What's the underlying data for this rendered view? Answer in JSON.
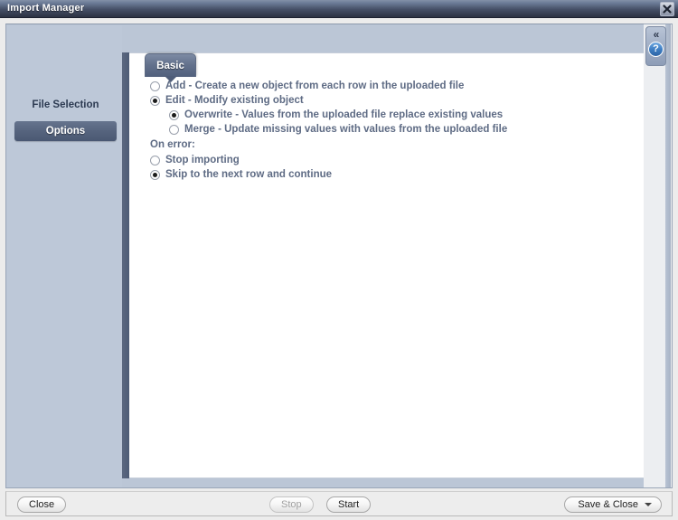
{
  "window": {
    "title": "Import Manager",
    "close_icon": "close-icon"
  },
  "sidebar": {
    "items": [
      {
        "label": "File Selection",
        "selected": false
      },
      {
        "label": "Options",
        "selected": true
      }
    ]
  },
  "tabs": [
    {
      "label": "Basic",
      "selected": true
    }
  ],
  "main": {
    "mode_group": {
      "options": [
        {
          "label": "Add - Create a new object from each row in the uploaded file",
          "selected": false,
          "indent": false
        },
        {
          "label": "Edit - Modify existing object",
          "selected": true,
          "indent": false
        },
        {
          "label": "Overwrite - Values from the uploaded file replace existing values",
          "selected": true,
          "indent": true
        },
        {
          "label": "Merge - Update missing values with values from the uploaded file",
          "selected": false,
          "indent": true
        }
      ]
    },
    "error_group": {
      "label": "On error:",
      "options": [
        {
          "label": "Stop importing",
          "selected": false
        },
        {
          "label": "Skip to the next row and continue",
          "selected": true
        }
      ]
    }
  },
  "rail": {
    "collapse_icon": "«",
    "help_icon": "?"
  },
  "footer": {
    "close_label": "Close",
    "stop_label": "Stop",
    "start_label": "Start",
    "save_label": "Save & Close"
  },
  "colors": {
    "titlebar_dark": "#2b3243",
    "sidebar_bg": "#bdc8d8",
    "selected_item": "#56647e",
    "label_text": "#5e6b84",
    "help_blue": "#3f7fc4"
  }
}
